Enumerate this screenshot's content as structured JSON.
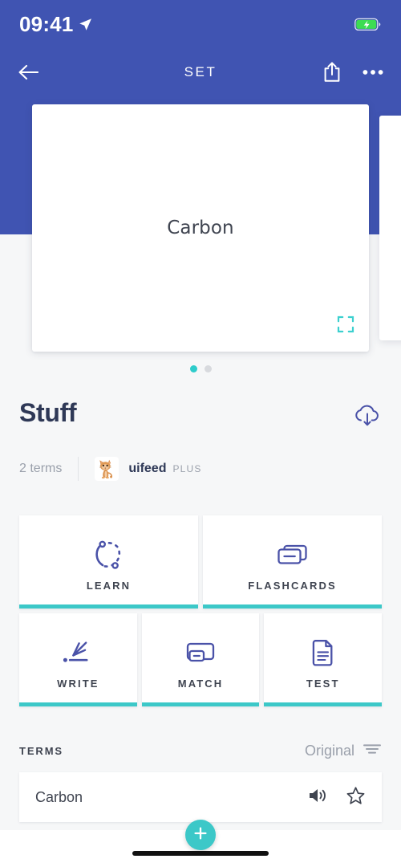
{
  "status_bar": {
    "time": "09:41",
    "location_icon": "location-arrow-icon",
    "battery_icon": "battery-charging-icon"
  },
  "nav_bar": {
    "back_icon": "back-arrow-icon",
    "title": "SET",
    "share_icon": "share-icon",
    "more_icon": "more-options-icon"
  },
  "carousel": {
    "current_card": {
      "term": "Carbon",
      "expand_icon": "expand-fullscreen-icon"
    },
    "dots": [
      {
        "active": true
      },
      {
        "active": false
      }
    ]
  },
  "set_header": {
    "title": "Stuff",
    "download_icon": "cloud-download-icon",
    "terms_count": "2 terms",
    "author": "uifeed",
    "author_badge": "PLUS",
    "avatar_icon": "cat-avatar"
  },
  "study_modes": [
    {
      "label": "LEARN",
      "icon": "learn-circle-icon"
    },
    {
      "label": "FLASHCARDS",
      "icon": "flashcards-stack-icon"
    },
    {
      "label": "WRITE",
      "icon": "write-pencil-icon"
    },
    {
      "label": "MATCH",
      "icon": "match-cards-icon"
    },
    {
      "label": "TEST",
      "icon": "test-document-icon"
    }
  ],
  "terms_section": {
    "label": "TERMS",
    "sort_value": "Original",
    "sort_icon": "filter-sort-icon",
    "rows": [
      {
        "term": "Carbon",
        "audio_icon": "speaker-icon",
        "star_icon": "star-outline-icon"
      }
    ]
  },
  "fab": {
    "icon": "plus-icon"
  },
  "colors": {
    "header_blue": "#4054b2",
    "accent_teal": "#3cc8c8",
    "icon_indigo": "#4a52a8",
    "text_dark": "#2e3856",
    "text_muted": "#9aa0ab"
  }
}
